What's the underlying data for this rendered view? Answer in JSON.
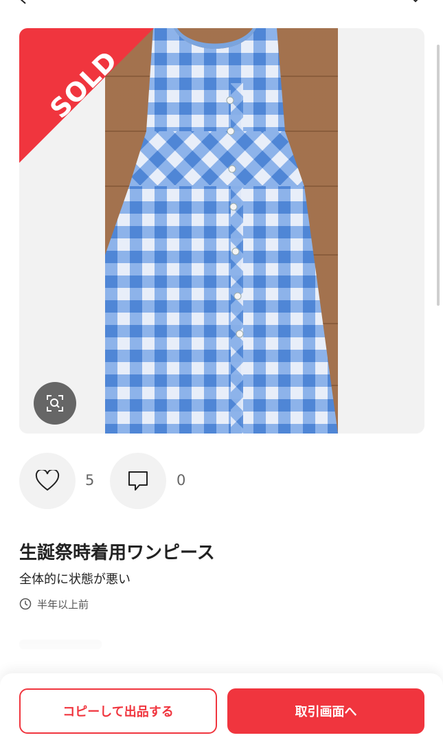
{
  "colors": {
    "accent": "#f0353e",
    "badge": "#f0353e"
  },
  "icons": {
    "back": "chevron-left-icon",
    "zoom": "zoom-scan-icon",
    "like": "heart-icon",
    "comment": "comment-icon",
    "clock": "clock-icon"
  },
  "product": {
    "badge": "SOLD",
    "title": "生誕祭時着用ワンピース",
    "condition": "全体的に状態が悪い",
    "posted": "半年以上前"
  },
  "stats": {
    "likes": "5",
    "comments": "0"
  },
  "footer": {
    "copy_button": "コピーして出品する",
    "trade_button": "取引画面へ"
  }
}
